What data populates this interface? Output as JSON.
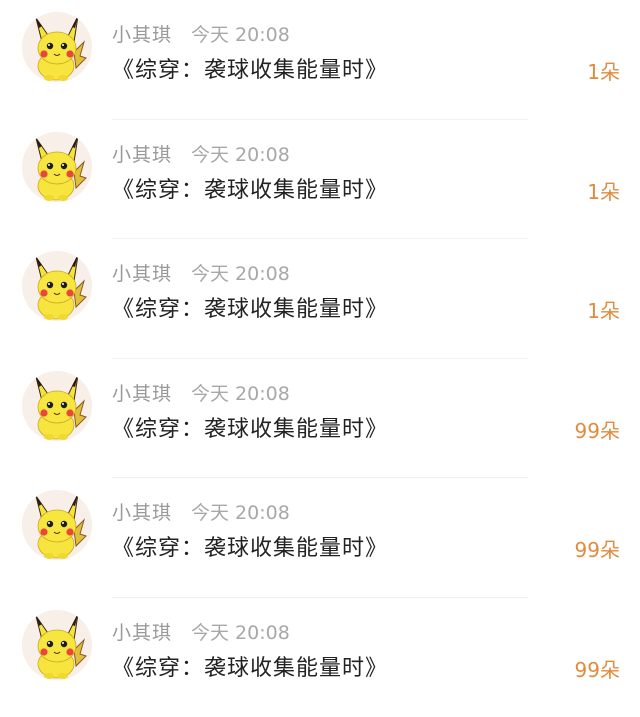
{
  "accent_color": "#e38a3c",
  "avatar_icon": "pikachu-avatar-icon",
  "rows": [
    {
      "user": "小其琪",
      "time": "今天 20:08",
      "title": "《综穿：袭球收集能量时》",
      "gift": "1朵"
    },
    {
      "user": "小其琪",
      "time": "今天 20:08",
      "title": "《综穿：袭球收集能量时》",
      "gift": "1朵"
    },
    {
      "user": "小其琪",
      "time": "今天 20:08",
      "title": "《综穿：袭球收集能量时》",
      "gift": "1朵"
    },
    {
      "user": "小其琪",
      "time": "今天 20:08",
      "title": "《综穿：袭球收集能量时》",
      "gift": "99朵"
    },
    {
      "user": "小其琪",
      "time": "今天 20:08",
      "title": "《综穿：袭球收集能量时》",
      "gift": "99朵"
    },
    {
      "user": "小其琪",
      "time": "今天 20:08",
      "title": "《综穿：袭球收集能量时》",
      "gift": "99朵"
    }
  ]
}
